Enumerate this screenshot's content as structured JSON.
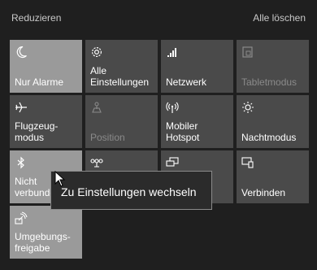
{
  "header": {
    "collapse_label": "Reduzieren",
    "clear_all_label": "Alle löschen"
  },
  "tiles": [
    {
      "label": "Nur Alarme",
      "icon": "moon-icon",
      "active": true
    },
    {
      "label": "Alle\nEinstellungen",
      "icon": "gear-icon",
      "active": false
    },
    {
      "label": "Netzwerk",
      "icon": "network-icon",
      "active": false
    },
    {
      "label": "Tabletmodus",
      "icon": "tablet-mode-icon",
      "active": false,
      "disabled": true
    },
    {
      "label": "Flugzeug-\nmodus",
      "icon": "airplane-icon",
      "active": false
    },
    {
      "label": "Position",
      "icon": "location-icon",
      "active": false,
      "disabled": true
    },
    {
      "label": "Mobiler\nHotspot",
      "icon": "hotspot-icon",
      "active": false
    },
    {
      "label": "Nachtmodus",
      "icon": "night-light-icon",
      "active": false
    },
    {
      "label": "Nicht\nverbunden",
      "icon": "bluetooth-icon",
      "active": true
    },
    {
      "label": "",
      "icon": "vpn-icon",
      "active": false
    },
    {
      "label": "",
      "icon": "project-icon",
      "active": false
    },
    {
      "label": "Verbinden",
      "icon": "connect-icon",
      "active": false
    },
    {
      "label": "Umgebungs-\nfreigabe",
      "icon": "nearby-sharing-icon",
      "active": true
    }
  ],
  "tooltip": {
    "text": "Zu Einstellungen wechseln"
  },
  "colors": {
    "background": "#1f1f1f",
    "tile": "#4a4a4a",
    "tile_active": "#9a9a9a"
  }
}
